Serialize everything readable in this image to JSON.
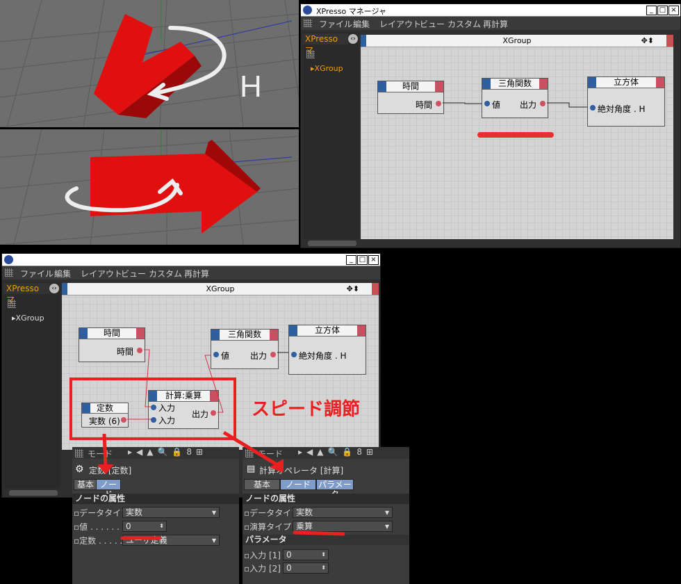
{
  "top_window": {
    "title": "XPresso マネージャ",
    "menu": [
      "ファイル",
      "編集",
      "レイアウト",
      "ビュー",
      "カスタム",
      "再計算"
    ],
    "tab_label": "XPresso マ",
    "tree_item": "XGroup",
    "editor_title": "XGroup",
    "nodes": {
      "time": {
        "title": "時間",
        "out": "時間"
      },
      "trig": {
        "title": "三角関数",
        "in": "値",
        "out": "出力"
      },
      "cube": {
        "title": "立方体",
        "in": "絶対角度 . H"
      }
    }
  },
  "viewport_top": {
    "annotation": "H"
  },
  "bottom_window": {
    "menu": [
      "ファイル",
      "編集",
      "レイアウト",
      "ビュー",
      "カスタム",
      "再計算"
    ],
    "tab_label": "XPresso マ",
    "tree_item": "XGroup",
    "editor_title": "XGroup",
    "nodes": {
      "time": {
        "title": "時間",
        "out": "時間"
      },
      "trig": {
        "title": "三角関数",
        "in": "値",
        "out": "出力"
      },
      "cube": {
        "title": "立方体",
        "in": "絶対角度 . H"
      },
      "const": {
        "title": "定数",
        "out": "実数 (6)"
      },
      "calc": {
        "title": "計算:乗算",
        "in1": "入力",
        "in2": "入力",
        "out": "出力"
      }
    },
    "annotation": "スピード調節"
  },
  "attr_left": {
    "mode_label": "モード",
    "object_title": "定数 [定数]",
    "tabs": [
      "基本",
      "ノード"
    ],
    "section": "ノードの属性",
    "rows": [
      {
        "label": "データタイプ",
        "value": "実数"
      },
      {
        "label": "値 . . . . . . .",
        "value": "0"
      },
      {
        "label": "定数 . . . . .",
        "value": "ユーザ定義"
      }
    ]
  },
  "attr_right": {
    "mode_label": "モード",
    "object_title": "計算オペレータ [計算]",
    "tabs": [
      "基本",
      "ノード",
      "パラメータ"
    ],
    "section": "ノードの属性",
    "rows": [
      {
        "label": "データタイプ",
        "value": "実数"
      },
      {
        "label": "演算タイプ",
        "value": "乗算"
      }
    ],
    "section2": "パラメータ",
    "params": [
      {
        "label": "入力 [1]",
        "value": "0"
      },
      {
        "label": "入力 [2]",
        "value": "0"
      }
    ]
  },
  "colors": {
    "accent_red": "#e82020",
    "port_in": "#2f5fa0",
    "port_out": "#d05060"
  }
}
